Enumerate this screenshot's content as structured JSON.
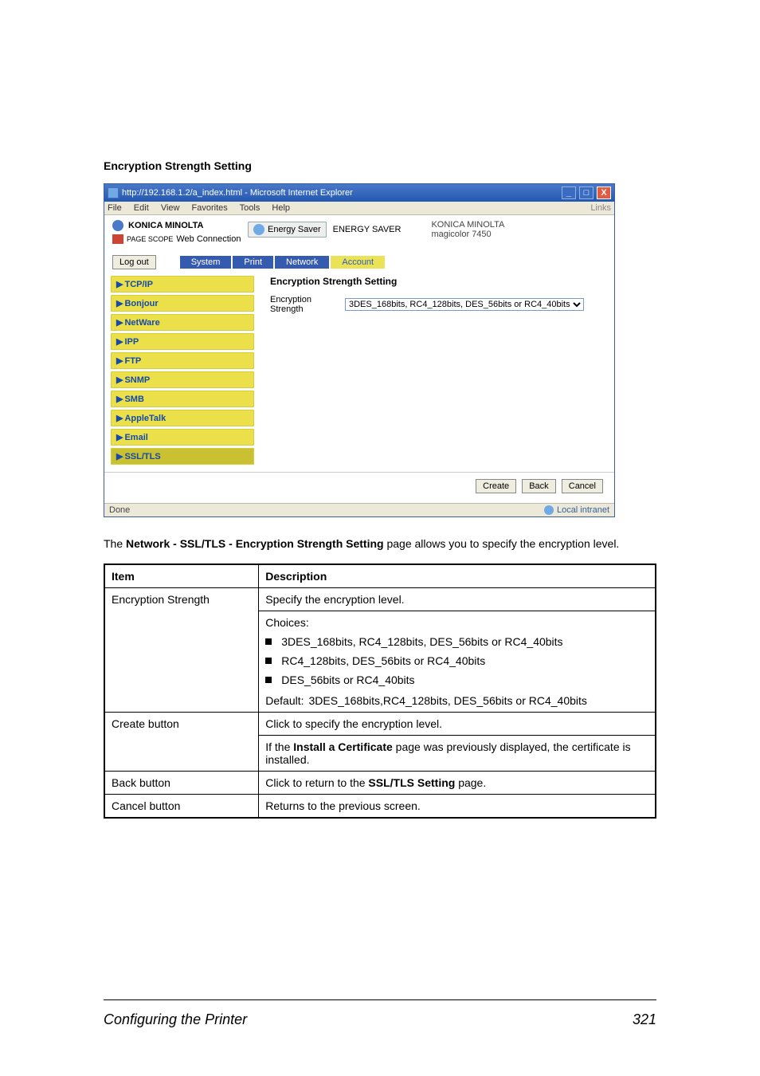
{
  "heading": "Encryption Strength Setting",
  "browser": {
    "title": "http://192.168.1.2/a_index.html - Microsoft Internet Explorer",
    "menus": [
      "File",
      "Edit",
      "View",
      "Favorites",
      "Tools",
      "Help"
    ],
    "links_label": "Links",
    "brand": "KONICA MINOLTA",
    "brand_sub_prefix": "PAGE SCOPE",
    "brand_sub": "Web Connection",
    "energy_btn": "Energy Saver",
    "energy_label": "ENERGY SAVER",
    "device_brand": "KONICA MINOLTA",
    "device_model": "magicolor 7450",
    "logout": "Log out",
    "tabs": [
      "System",
      "Print",
      "Network",
      "Account"
    ],
    "side_items": [
      "TCP/IP",
      "Bonjour",
      "NetWare",
      "IPP",
      "FTP",
      "SNMP",
      "SMB",
      "AppleTalk",
      "Email",
      "SSL/TLS"
    ],
    "main_title": "Encryption Strength Setting",
    "enc_label": "Encryption Strength",
    "enc_options": [
      "3DES_168bits, RC4_128bits, DES_56bits or RC4_40bits",
      "RC4_128bits, DES_56bits or RC4_40bits",
      "DES_56bits or RC4_40bits"
    ],
    "enc_selected": "3DES_168bits, RC4_128bits, DES_56bits or RC4_40bits",
    "btn_create": "Create",
    "btn_back": "Back",
    "btn_cancel": "Cancel",
    "status_done": "Done",
    "status_zone": "Local intranet"
  },
  "para_pre": "The ",
  "para_bold": "Network - SSL/TLS - Encryption Strength Setting",
  "para_post": " page allows you to specify the encryption level.",
  "table": {
    "h_item": "Item",
    "h_desc": "Description",
    "r1_item": "Encryption Strength",
    "r1_line1": "Specify the encryption level.",
    "r1_line2": "Choices:",
    "r1_opts": [
      "3DES_168bits, RC4_128bits, DES_56bits or RC4_40bits",
      "RC4_128bits, DES_56bits or RC4_40bits",
      "DES_56bits or RC4_40bits"
    ],
    "r1_default_label": "Default:",
    "r1_default_val": "3DES_168bits,RC4_128bits, DES_56bits or RC4_40bits",
    "r2_item": "Create button",
    "r2_line1": "Click to specify the encryption level.",
    "r2_line2a": "If the ",
    "r2_bold": "Install a Certificate",
    "r2_line2b": " page was previously displayed, the certificate is installed.",
    "r3_item": "Back button",
    "r3_desc_a": "Click to return to the ",
    "r3_bold": "SSL/TLS Setting",
    "r3_desc_b": " page.",
    "r4_item": "Cancel button",
    "r4_desc": "Returns to the previous screen."
  },
  "footer_left": "Configuring the Printer",
  "footer_right": "321"
}
